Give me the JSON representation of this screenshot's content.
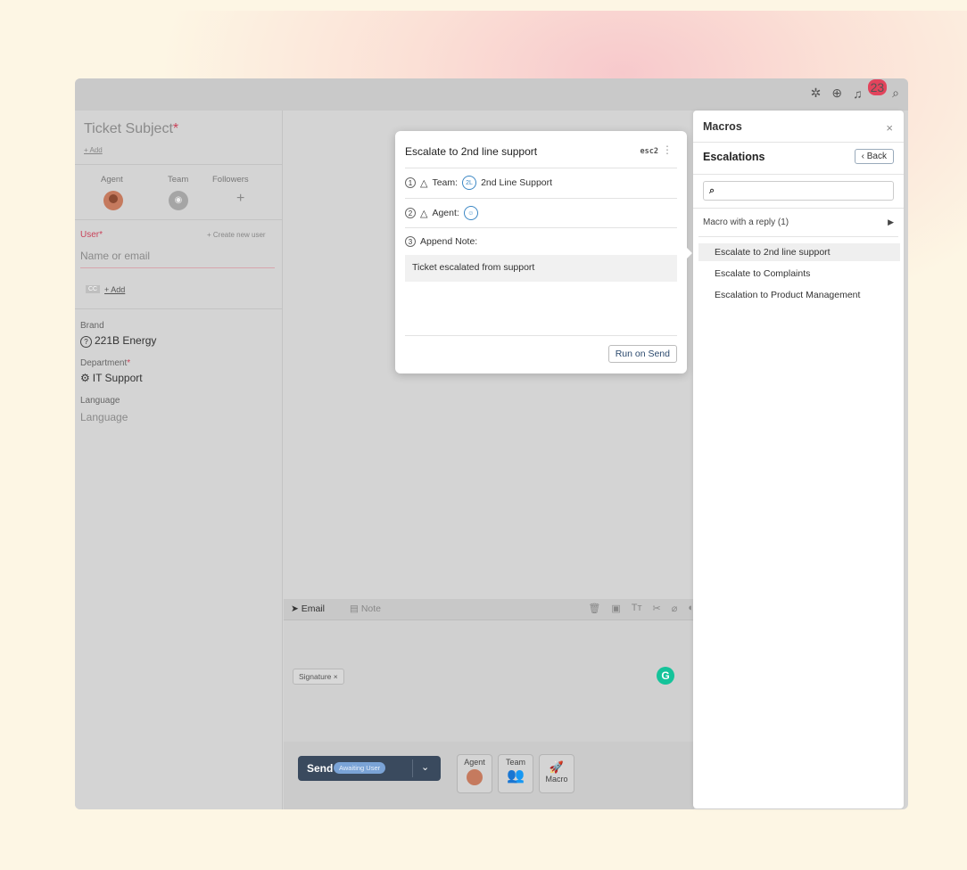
{
  "topbar": {
    "bell_count": "23"
  },
  "ticket": {
    "subject_label": "Ticket Subject",
    "required_mark": "*",
    "add_label": "+ Add"
  },
  "assign": {
    "agent": "Agent",
    "team": "Team",
    "followers": "Followers",
    "plus": "+"
  },
  "user": {
    "label": "User",
    "required_mark": "*",
    "create": "+ Create new user",
    "placeholder": "Name or email",
    "cc_add": "+ Add",
    "cc_icon": "CC"
  },
  "brand": {
    "label": "Brand",
    "value": "221B Energy"
  },
  "department": {
    "label": "Department",
    "required_mark": "*",
    "value": "IT Support"
  },
  "language": {
    "label": "Language",
    "placeholder": "Language"
  },
  "editor": {
    "tab_email": "Email",
    "tab_note": "Note",
    "signature": "Signature ×"
  },
  "bottom": {
    "send": "Send",
    "status_badge": "Awaiting User",
    "agent": "Agent",
    "team": "Team",
    "macro": "Macro"
  },
  "popup": {
    "title": "Escalate to 2nd line support",
    "code": "esc2",
    "step1_num": "1",
    "step1_label": "Team:",
    "step1_chip": "2L",
    "step1_value": "2nd Line Support",
    "step2_num": "2",
    "step2_label": "Agent:",
    "step3_num": "3",
    "step3_label": "Append Note:",
    "note_text": "Ticket escalated from support",
    "run_button": "Run on Send"
  },
  "macros": {
    "title": "Macros",
    "close": "×",
    "section": "Escalations",
    "back": "Back",
    "group": "Macro with a reply (1)",
    "items": [
      "Escalate to 2nd line support",
      "Escalate to Complaints",
      "Escalation to Product Management"
    ]
  }
}
